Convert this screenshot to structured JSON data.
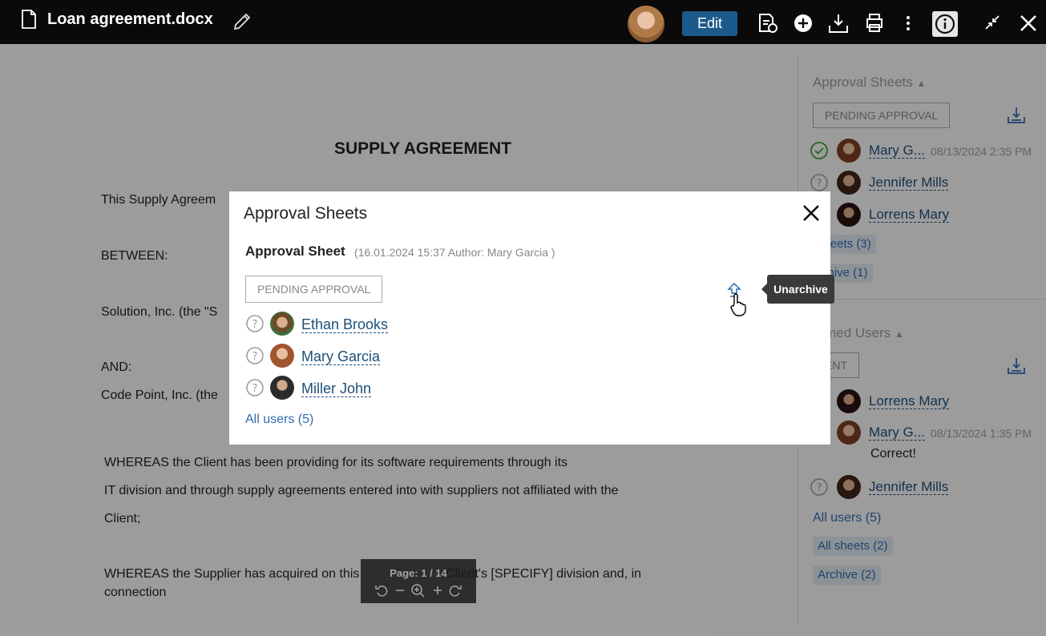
{
  "topbar": {
    "title": "Loan agreement.docx",
    "edit_label": "Edit",
    "icons": [
      "file-icon",
      "pencil-icon",
      "avatar",
      "approval-sheet-icon",
      "add-icon",
      "download-icon",
      "print-icon",
      "more-icon",
      "info-icon",
      "collapse-icon",
      "close-icon"
    ]
  },
  "document": {
    "heading": "SUPPLY AGREEMENT",
    "lines": [
      "This Supply Agreem",
      "BETWEEN:",
      "Solution, Inc. (the \"S",
      "AND:",
      "Code Point, Inc. (the",
      "WHEREAS the Client has been providing for its software requirements through its",
      "IT division and through supply agreements entered into with suppliers not affiliated with the",
      "Client;",
      "WHEREAS the Supplier has acquired on this",
      "Client's [SPECIFY] division and, in",
      "connection"
    ]
  },
  "panel": {
    "approval_title": "Approval Sheets",
    "approval_status": "PENDING APPROVAL",
    "approval_users": [
      {
        "name": "Mary G...",
        "time": "08/13/2024 2:35 PM",
        "status": "approved"
      },
      {
        "name": "Jennifer Mills",
        "time": "",
        "status": "pending"
      },
      {
        "name": "Lorrens Mary",
        "time": "",
        "status": "none"
      }
    ],
    "chip_sheets": "sheets (3)",
    "chip_archive": "rchive (1)",
    "informed_title": "ormed Users",
    "informed_status": "ENT",
    "informed_users": [
      {
        "name": "Lorrens Mary",
        "time": "",
        "status": "none"
      },
      {
        "name": "Mary G...",
        "time": "08/13/2024 1:35 PM",
        "status": "none"
      },
      {
        "name": "Jennifer Mills",
        "time": "",
        "status": "pending"
      }
    ],
    "comment": "Correct!",
    "all_users": "All users (5)",
    "all_sheets": "All sheets (2)",
    "archive": "Archive (2)"
  },
  "modal": {
    "title": "Approval Sheets",
    "sheet_title": "Approval Sheet",
    "sheet_meta": "(16.01.2024 15:37 Author: Mary Garcia )",
    "status": "PENDING APPROVAL",
    "users": [
      {
        "name": "Ethan Brooks"
      },
      {
        "name": "Mary Garcia"
      },
      {
        "name": "Miller John"
      }
    ],
    "all_users": "All users (5)"
  },
  "tooltip": "Unarchive",
  "pagebar": {
    "page_label": "Page: 1 / 14"
  }
}
